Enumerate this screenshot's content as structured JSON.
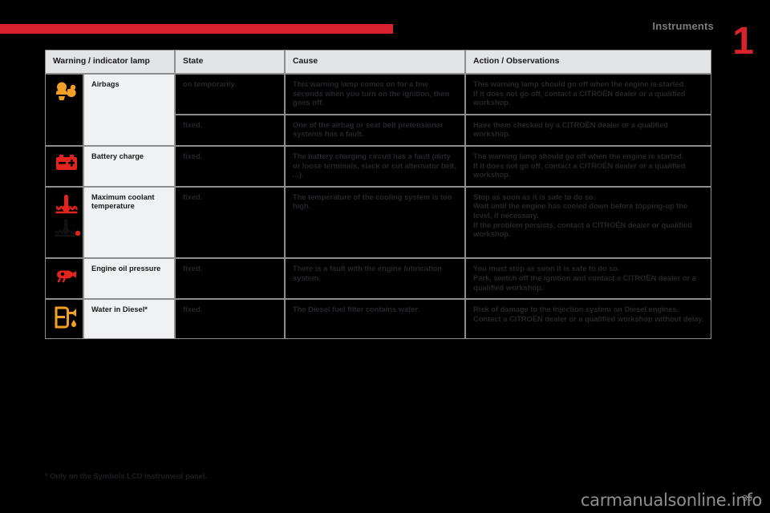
{
  "header": {
    "section_title": "Instruments",
    "chapter_number": "1"
  },
  "table": {
    "columns": [
      "Warning / indicator lamp",
      "State",
      "Cause",
      "Action / Observations"
    ],
    "rows": [
      {
        "icon": "airbag-warning-icon",
        "icon_color": "#f0a024",
        "name": "Airbags",
        "states": [
          {
            "state": "on temporarily.",
            "cause": "This warning lamp comes on for a few seconds when you turn on the ignition, then goes off.",
            "action": "This warning lamp should go off when the engine is started.\nIf it does not go off, contact a CITROËN dealer or a qualified workshop."
          },
          {
            "state": "fixed.",
            "cause": "One of the airbag or seat belt pretensioner systems has a fault.",
            "action": "Have them checked by a CITROËN dealer or a qualified workshop."
          }
        ]
      },
      {
        "icon": "battery-charge-icon",
        "icon_color": "#e3231e",
        "name": "Battery charge",
        "states": [
          {
            "state": "fixed.",
            "cause": "The battery charging circuit has a fault (dirty or loose terminals, slack or cut alternator belt, ...).",
            "action": "The warning lamp should go off when the engine is started.\nIf it does not go off, contact a CITROËN dealer or a qualified workshop."
          }
        ]
      },
      {
        "icon": "coolant-temperature-icon",
        "icon_color": "#e3231e",
        "name": "Maximum coolant temperature",
        "states": [
          {
            "state": "fixed.",
            "cause": "The temperature of the cooling system is too high.",
            "action": "Stop as soon as it is safe to do so.\nWait until the engine has cooled down before topping-up the level, if necessary.\nIf the problem persists, contact a CITROËN dealer or qualified workshop."
          }
        ]
      },
      {
        "icon": "engine-oil-pressure-icon",
        "icon_color": "#e3231e",
        "name": "Engine oil pressure",
        "states": [
          {
            "state": "fixed.",
            "cause": "There is a fault with the engine lubrication system.",
            "action": "You must stop as soon it is safe to do so.\nPark, switch off the ignition and contact a CITROËN dealer or a qualified workshop."
          }
        ]
      },
      {
        "icon": "water-in-diesel-icon",
        "icon_color": "#f0a024",
        "name": "Water in Diesel*",
        "states": [
          {
            "state": "fixed.",
            "cause": "The Diesel fuel filter contains water.",
            "action": "Risk of damage to the injection system on Diesel engines.\nContact a CITROËN dealer or a qualified workshop without delay."
          }
        ]
      }
    ]
  },
  "footnote": "* Only on the Symbols LCD instrument panel.",
  "footer": {
    "page_number": "35",
    "watermark": "carmanualsonline.info"
  },
  "colors": {
    "accent_red": "#d8232f",
    "header_bg": "#e3e4e6",
    "name_cell_bg": "#f0f1f3",
    "page_bg": "#000000"
  }
}
